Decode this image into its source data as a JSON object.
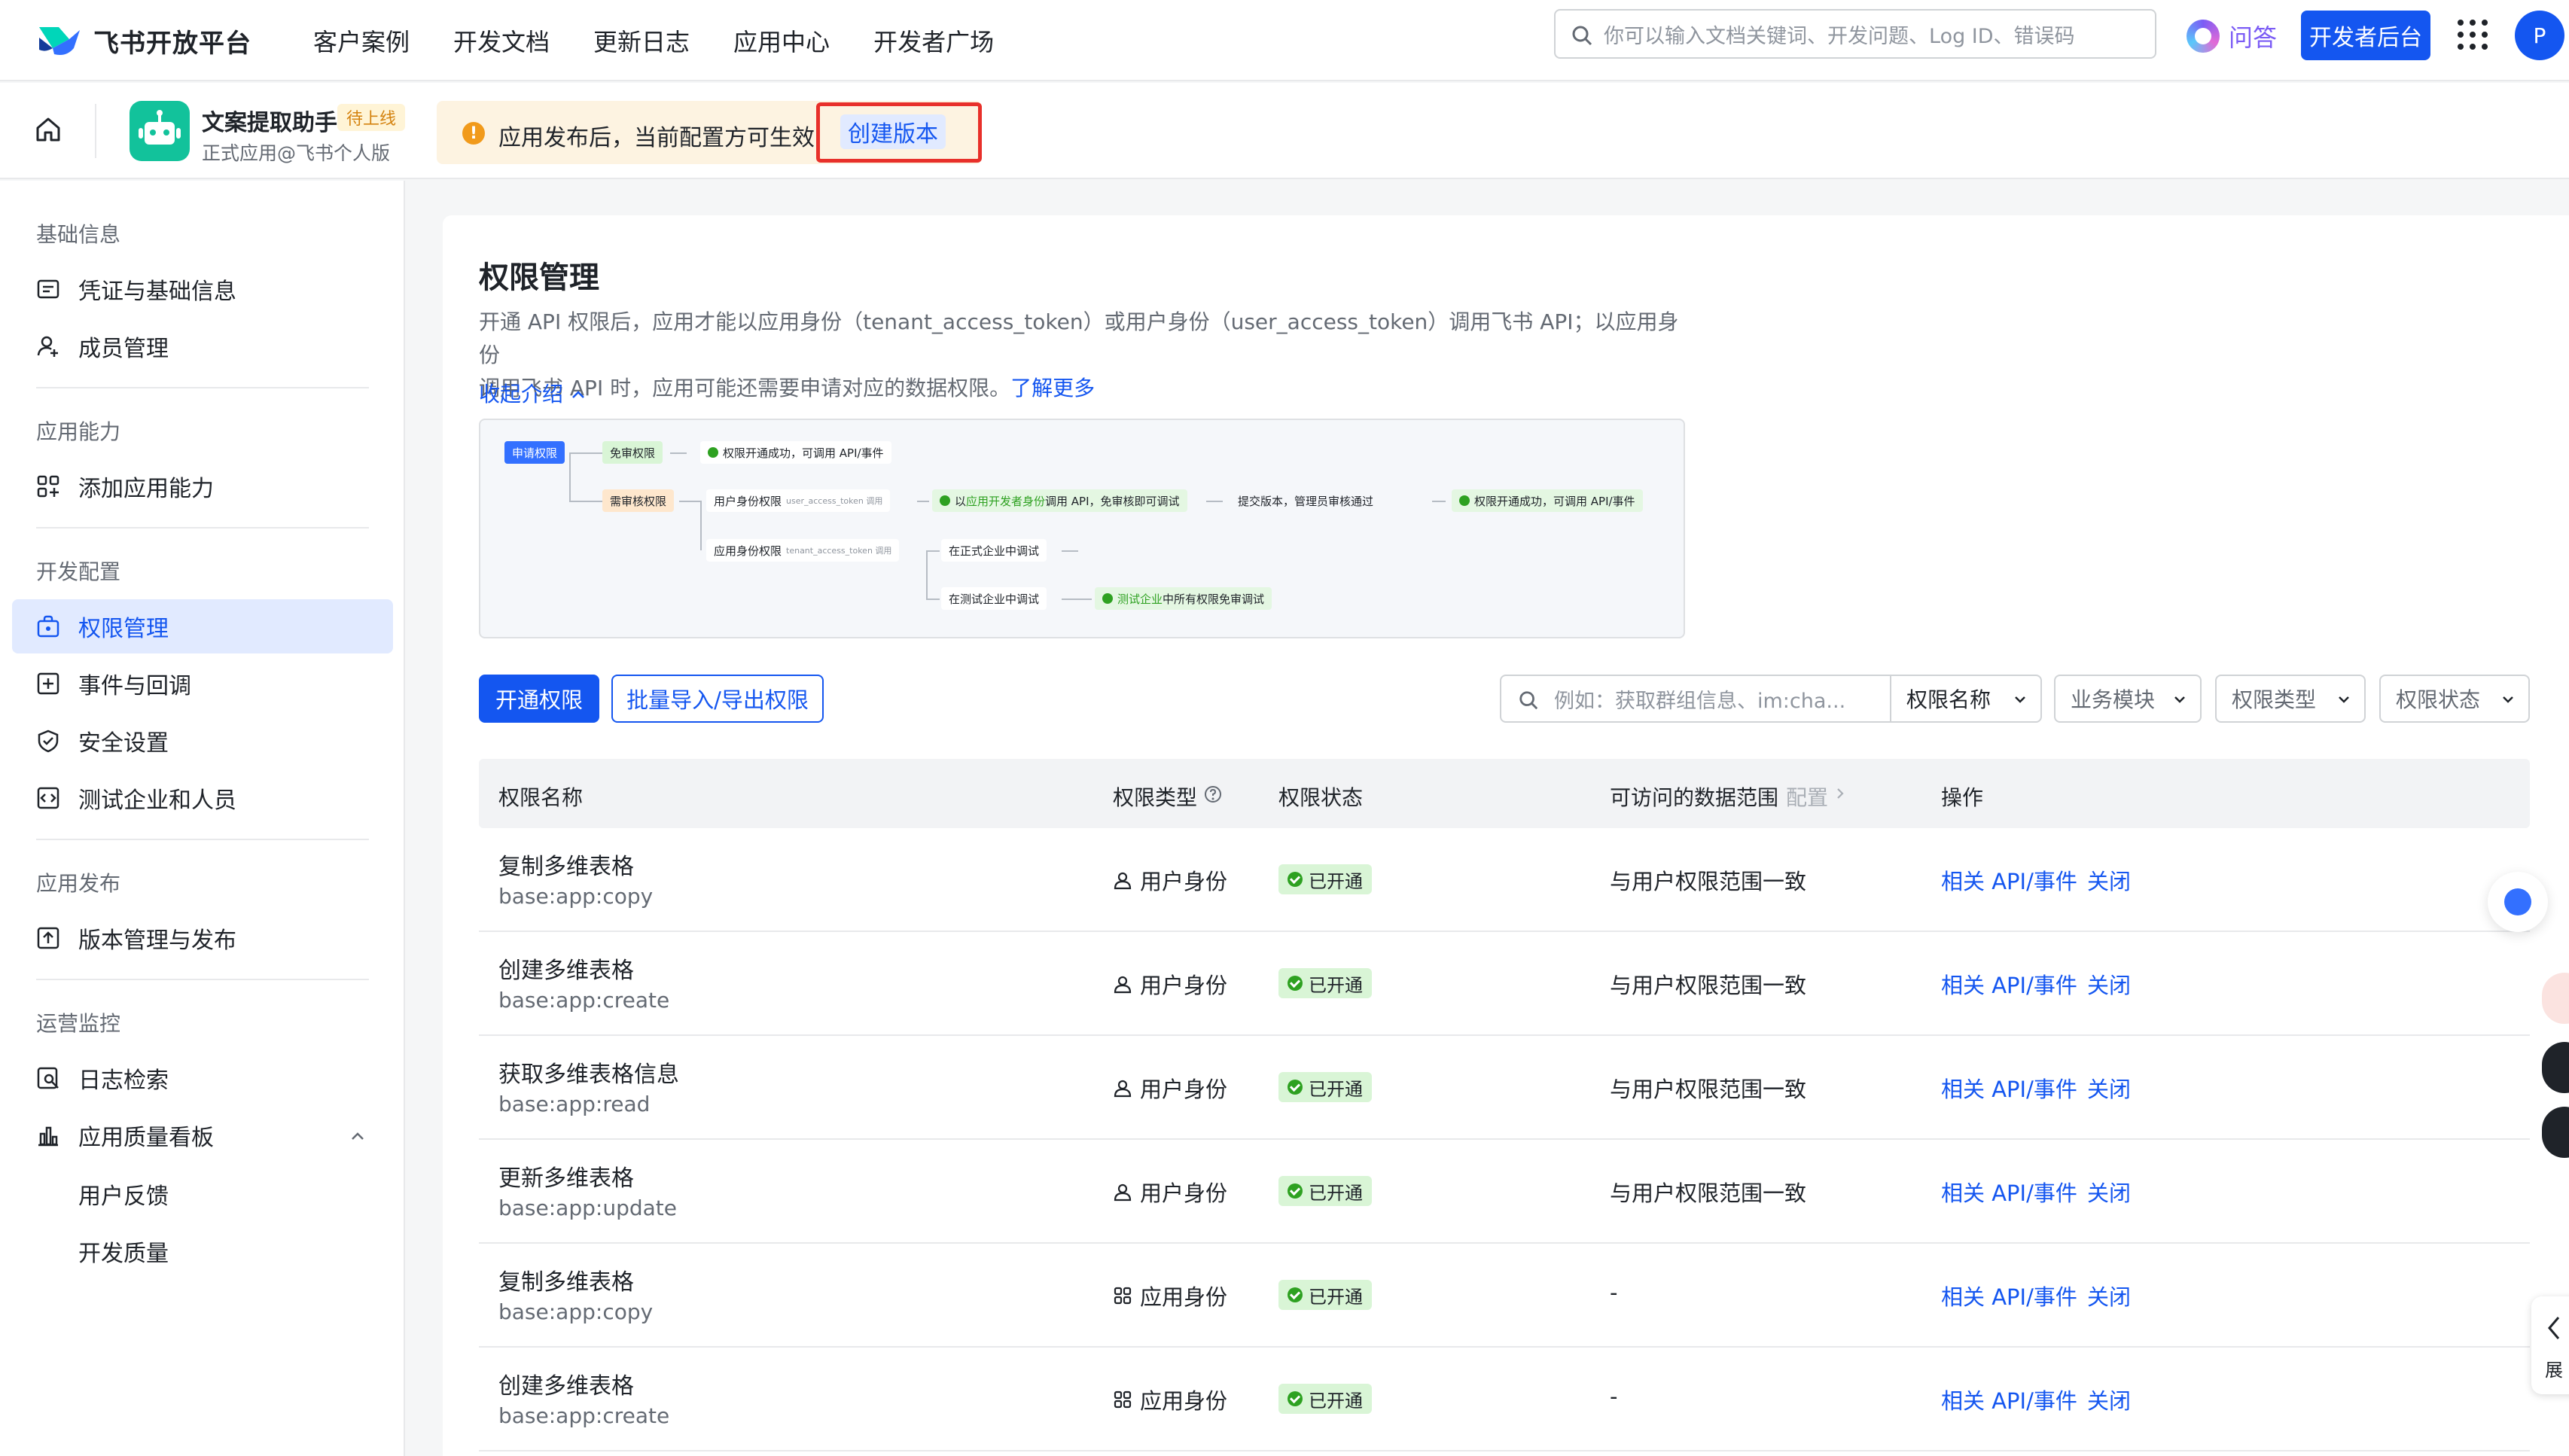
{
  "nav": {
    "logo_text": "飞书开放平台",
    "links": [
      "客户案例",
      "开发文档",
      "更新日志",
      "应用中心",
      "开发者广场"
    ],
    "search_placeholder": "你可以输入文档关键词、开发问题、Log ID、错误码",
    "qa_label": "问答",
    "dev_console": "开发者后台",
    "avatar_initial": "P"
  },
  "appbar": {
    "app_name": "文案提取助手",
    "status_tag": "待上线",
    "app_sub": "正式应用@飞书个人版",
    "notice": "应用发布后，当前配置方可生效",
    "create_version": "创建版本"
  },
  "sidebar": {
    "sections": [
      {
        "title": "基础信息",
        "items": [
          {
            "label": "凭证与基础信息",
            "icon": "id-card-icon"
          },
          {
            "label": "成员管理",
            "icon": "user-add-icon"
          }
        ]
      },
      {
        "title": "应用能力",
        "items": [
          {
            "label": "添加应用能力",
            "icon": "apps-add-icon"
          }
        ]
      },
      {
        "title": "开发配置",
        "items": [
          {
            "label": "权限管理",
            "icon": "lock-bag-icon",
            "active": true
          },
          {
            "label": "事件与回调",
            "icon": "event-icon"
          },
          {
            "label": "安全设置",
            "icon": "shield-icon"
          },
          {
            "label": "测试企业和人员",
            "icon": "code-icon"
          }
        ]
      },
      {
        "title": "应用发布",
        "items": [
          {
            "label": "版本管理与发布",
            "icon": "upload-icon"
          }
        ]
      },
      {
        "title": "运营监控",
        "items": [
          {
            "label": "日志检索",
            "icon": "log-search-icon"
          },
          {
            "label": "应用质量看板",
            "icon": "bar-chart-icon"
          }
        ],
        "subitems": [
          "用户反馈",
          "开发质量"
        ]
      }
    ]
  },
  "main": {
    "title": "权限管理",
    "desc_line1": "开通 API 权限后，应用才能以应用身份（tenant_access_token）或用户身份（user_access_token）调用飞书 API；以应用身份",
    "desc_line2": "调用飞书 API 时，应用可能还需要申请对应的数据权限。",
    "learn_more": "了解更多",
    "collapse": "收起介绍",
    "flow": {
      "apply": "申请权限",
      "free": "免审权限",
      "free_result": "权限开通成功，可调用 API/事件",
      "review": "需审核权限",
      "user_id": "用户身份权限",
      "user_token": "user_access_token 调用",
      "dev_test_pre": "以",
      "dev_test_hl": "应用开发者身份",
      "dev_test_post": "调用 API，免审核即可调试",
      "submit": "提交版本，管理员审核通过",
      "final_result": "权限开通成功，可调用 API/事件",
      "app_id": "应用身份权限",
      "app_token": "tenant_access_token 调用",
      "prod_test": "在正式企业中调试",
      "test_ent": "在测试企业中调试",
      "test_free_hl": "测试企业",
      "test_free_post": "中所有权限免审调试"
    },
    "btn_open": "开通权限",
    "btn_batch": "批量导入/导出权限",
    "filter_placeholder": "例如：获取群组信息、im:cha...",
    "filter_field": "权限名称",
    "filters": [
      "业务模块",
      "权限类型",
      "权限状态"
    ],
    "table": {
      "headers": {
        "name": "权限名称",
        "type": "权限类型",
        "status": "权限状态",
        "scope": "可访问的数据范围",
        "scope_config": "配置",
        "ops": "操作"
      },
      "rows": [
        {
          "name": "复制多维表格",
          "code": "base:app:copy",
          "type": "用户身份",
          "status": "已开通",
          "scope": "与用户权限范围一致",
          "op1": "相关 API/事件",
          "op2": "关闭"
        },
        {
          "name": "创建多维表格",
          "code": "base:app:create",
          "type": "用户身份",
          "status": "已开通",
          "scope": "与用户权限范围一致",
          "op1": "相关 API/事件",
          "op2": "关闭"
        },
        {
          "name": "获取多维表格信息",
          "code": "base:app:read",
          "type": "用户身份",
          "status": "已开通",
          "scope": "与用户权限范围一致",
          "op1": "相关 API/事件",
          "op2": "关闭"
        },
        {
          "name": "更新多维表格",
          "code": "base:app:update",
          "type": "用户身份",
          "status": "已开通",
          "scope": "与用户权限范围一致",
          "op1": "相关 API/事件",
          "op2": "关闭"
        },
        {
          "name": "复制多维表格",
          "code": "base:app:copy",
          "type": "应用身份",
          "status": "已开通",
          "scope": "-",
          "op1": "相关 API/事件",
          "op2": "关闭"
        },
        {
          "name": "创建多维表格",
          "code": "base:app:create",
          "type": "应用身份",
          "status": "已开通",
          "scope": "-",
          "op1": "相关 API/事件",
          "op2": "关闭"
        }
      ]
    }
  },
  "float": {
    "expand_label": "展"
  },
  "colors": {
    "primary": "#1456f0",
    "success": "#2ea121",
    "highlight": "#e8302a"
  }
}
